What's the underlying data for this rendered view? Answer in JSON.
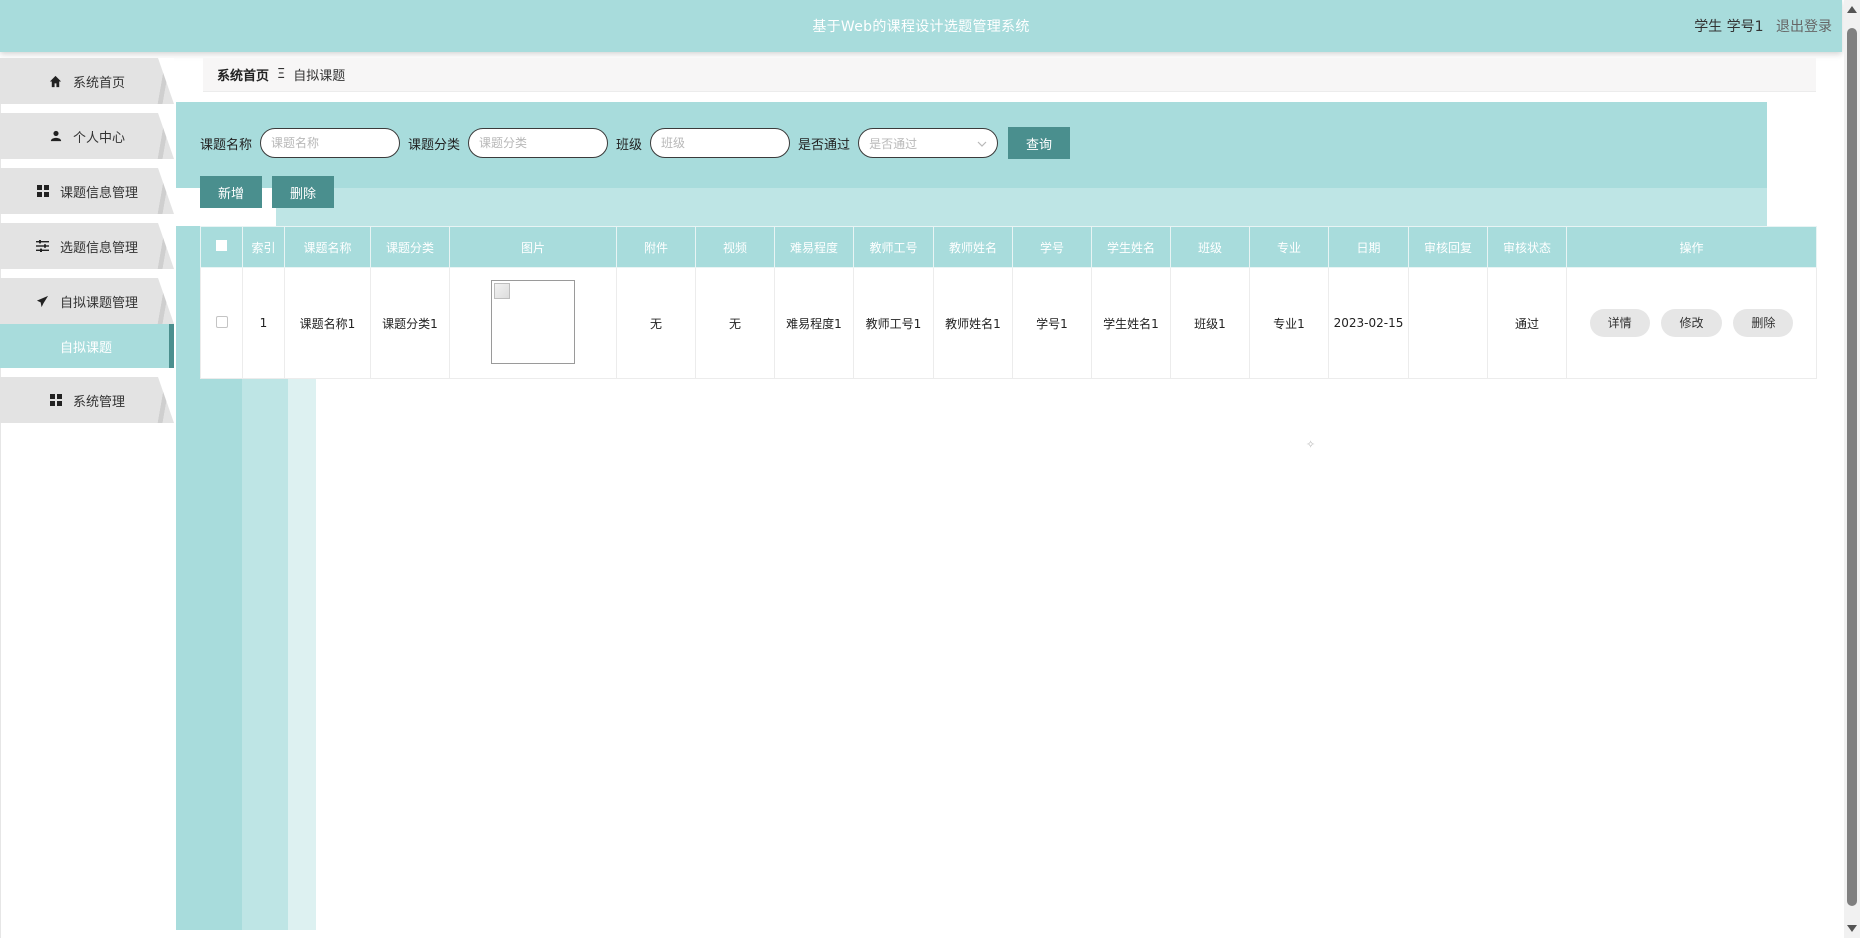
{
  "header": {
    "title": "基于Web的课程设计选题管理系统",
    "user_label": "学生 学号1",
    "logout_label": "退出登录"
  },
  "sidebar": {
    "items": [
      {
        "label": "系统首页",
        "icon": "home-icon"
      },
      {
        "label": "个人中心",
        "icon": "user-icon"
      },
      {
        "label": "课题信息管理",
        "icon": "grid-icon"
      },
      {
        "label": "选题信息管理",
        "icon": "sliders-icon"
      },
      {
        "label": "自拟课题管理",
        "icon": "send-icon"
      },
      {
        "label": "系统管理",
        "icon": "grid-icon"
      }
    ],
    "active_sub": "自拟课题"
  },
  "breadcrumb": {
    "home": "系统首页",
    "separator": "Ξ",
    "current": "自拟课题"
  },
  "search": {
    "name_label": "课题名称",
    "name_placeholder": "课题名称",
    "category_label": "课题分类",
    "category_placeholder": "课题分类",
    "class_label": "班级",
    "class_placeholder": "班级",
    "passed_label": "是否通过",
    "passed_placeholder": "是否通过",
    "query_label": "查询"
  },
  "actions": {
    "add_label": "新增",
    "delete_label": "删除"
  },
  "table": {
    "headers": [
      "索引",
      "课题名称",
      "课题分类",
      "图片",
      "附件",
      "视频",
      "难易程度",
      "教师工号",
      "教师姓名",
      "学号",
      "学生姓名",
      "班级",
      "专业",
      "日期",
      "审核回复",
      "审核状态",
      "操作"
    ],
    "rows": [
      {
        "index": "1",
        "name": "课题名称1",
        "category": "课题分类1",
        "attachment": "无",
        "video": "无",
        "difficulty": "难易程度1",
        "teacher_id": "教师工号1",
        "teacher_name": "教师姓名1",
        "student_id": "学号1",
        "student_name": "学生姓名1",
        "class": "班级1",
        "major": "专业1",
        "date": "2023-02-15",
        "review_reply": "",
        "review_status": "通过",
        "ops": {
          "detail": "详情",
          "edit": "修改",
          "delete": "删除"
        }
      }
    ]
  },
  "colors": {
    "primary_teal": "#a8dcdc",
    "dark_teal": "#4a8f8e",
    "light_teal": "#bee5e5"
  }
}
